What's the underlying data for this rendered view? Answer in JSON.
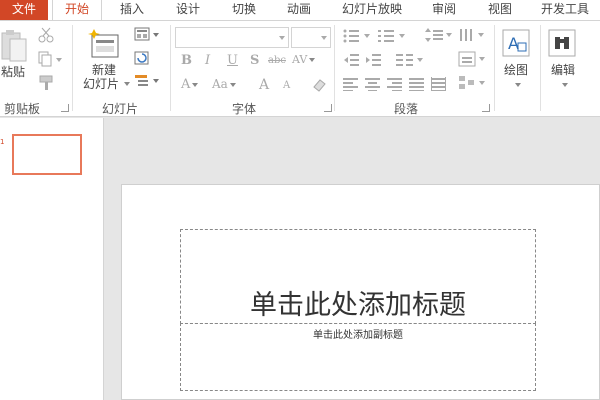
{
  "tabs": {
    "file": "文件",
    "home": "开始",
    "insert": "插入",
    "design": "设计",
    "transitions": "切换",
    "animations": "动画",
    "slideshow": "幻灯片放映",
    "review": "审阅",
    "view": "视图",
    "developer": "开发工具"
  },
  "ribbon": {
    "clipboard": {
      "group_label": "剪贴板",
      "paste_label": "粘贴"
    },
    "slides": {
      "group_label": "幻灯片",
      "new_slide_line1": "新建",
      "new_slide_line2": "幻灯片"
    },
    "font": {
      "group_label": "字体",
      "bold": "B",
      "italic": "I",
      "underline": "U",
      "shadow": "S",
      "strike": "abc",
      "spacing": "AV",
      "font_color": "A",
      "change_case": "Aa",
      "grow": "A",
      "shrink": "A"
    },
    "paragraph": {
      "group_label": "段落"
    },
    "drawing": {
      "label": "绘图"
    },
    "editing": {
      "label": "编辑"
    }
  },
  "thumbnail": {
    "number": "1"
  },
  "slide": {
    "title_placeholder": "单击此处添加标题",
    "subtitle_placeholder": "单击此处添加副标题"
  },
  "colors": {
    "accent": "#d24726",
    "thumb_border": "#e8795a"
  }
}
